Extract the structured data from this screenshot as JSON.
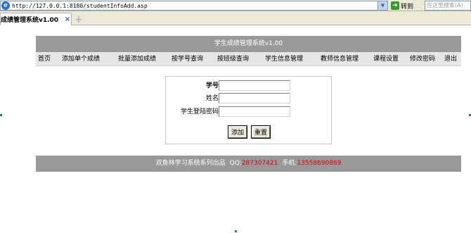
{
  "browser": {
    "url": "http://127.0.0.1:8180/studentInfoAdd.asp",
    "go_label": "转到",
    "search_placeholder": "在这里搜索(A)",
    "tab_title": "成绩管理系统v1.00",
    "tab_close": "×",
    "new_tab": "+"
  },
  "header": {
    "title": "学生成绩管理系统v1.00"
  },
  "nav": {
    "items": [
      {
        "label": "首页"
      },
      {
        "label": "添加单个成绩"
      },
      {
        "label": "批量添加成绩"
      },
      {
        "label": "按学号查询"
      },
      {
        "label": "按班级查询"
      },
      {
        "label": "学生信息管理"
      },
      {
        "label": "教师信息管理"
      },
      {
        "label": "课程设置"
      },
      {
        "label": "修改密码"
      },
      {
        "label": "退出"
      }
    ]
  },
  "form": {
    "fields": [
      {
        "label": "学号",
        "value": ""
      },
      {
        "label": "姓名",
        "value": ""
      },
      {
        "label": "学生登陆密码",
        "value": ""
      }
    ],
    "submit_label": "添加",
    "reset_label": "重置"
  },
  "footer": {
    "brand": "双鱼林学习系统系列出品",
    "qq_label": "QQ:",
    "qq_value": "287307421",
    "phone_label": "手机:",
    "phone_value": "13558690869"
  }
}
